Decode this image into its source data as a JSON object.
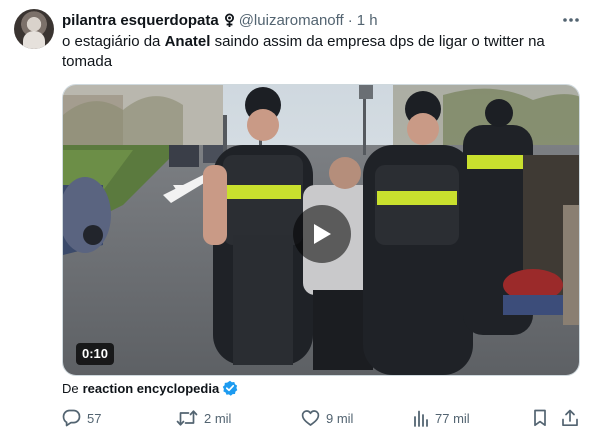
{
  "tweet": {
    "display_name": "pilantra esquerdopata",
    "handle": "@luizaromanoff",
    "separator": "·",
    "time": "1 h",
    "text_before": "o estagiário da ",
    "text_bold": "Anatel",
    "text_after": " saindo assim da empresa dps de ligar o twitter na tomada"
  },
  "media": {
    "duration": "0:10"
  },
  "source": {
    "prefix": "De",
    "name": "reaction encyclopedia"
  },
  "actions": {
    "replies": "57",
    "retweets": "2 mil",
    "likes": "9 mil",
    "views": "77 mil"
  },
  "colors": {
    "text": "#0f1419",
    "secondary": "#536471",
    "verified": "#1d9bf0"
  },
  "icons": [
    "venus-symbol-icon",
    "more-icon",
    "play-icon",
    "verified-badge-icon",
    "reply-icon",
    "retweet-icon",
    "like-icon",
    "views-icon",
    "bookmark-icon",
    "share-icon"
  ]
}
